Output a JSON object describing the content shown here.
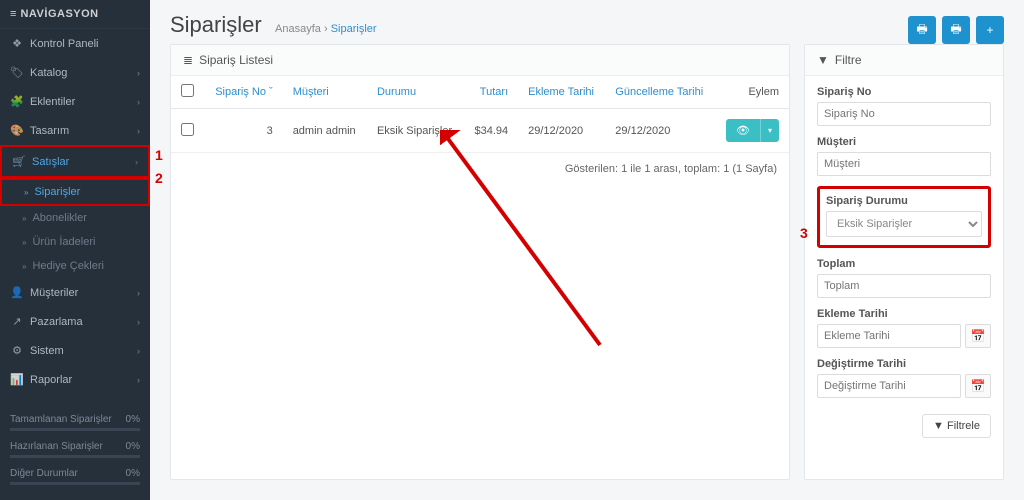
{
  "sidebar": {
    "title": "≡ NAVİGASYON",
    "items": [
      {
        "icon": "❖",
        "label": "Kontrol Paneli",
        "expandable": false
      },
      {
        "icon": "🏷",
        "label": "Katalog",
        "expandable": true
      },
      {
        "icon": "🧩",
        "label": "Eklentiler",
        "expandable": true
      },
      {
        "icon": "🎨",
        "label": "Tasarım",
        "expandable": true
      },
      {
        "icon": "🛒",
        "label": "Satışlar",
        "expandable": true,
        "active": true,
        "subs": [
          {
            "label": "Siparişler",
            "active": true
          },
          {
            "label": "Abonelikler"
          },
          {
            "label": "Ürün İadeleri"
          },
          {
            "label": "Hediye Çekleri"
          }
        ]
      },
      {
        "icon": "👤",
        "label": "Müşteriler",
        "expandable": true
      },
      {
        "icon": "↗",
        "label": "Pazarlama",
        "expandable": true
      },
      {
        "icon": "⚙",
        "label": "Sistem",
        "expandable": true
      },
      {
        "icon": "📊",
        "label": "Raporlar",
        "expandable": true
      }
    ],
    "gauges": [
      {
        "label": "Tamamlanan Siparişler",
        "value": "0%"
      },
      {
        "label": "Hazırlanan Siparişler",
        "value": "0%"
      },
      {
        "label": "Diğer Durumlar",
        "value": "0%"
      }
    ]
  },
  "page": {
    "title": "Siparişler",
    "breadcrumb": {
      "home": "Anasayfa",
      "sep": "›",
      "current": "Siparişler"
    },
    "actions": {
      "invoice_icon": "🖶",
      "shipping_icon": "🖶",
      "add_icon": "+"
    }
  },
  "list": {
    "panel_title": "Sipariş Listesi",
    "columns": {
      "siparis_no": "Sipariş No",
      "siparis_no_caret": "ˇ",
      "musteri": "Müşteri",
      "durumu": "Durumu",
      "tutari": "Tutarı",
      "ekleme": "Ekleme Tarihi",
      "guncelleme": "Güncelleme Tarihi",
      "eylem": "Eylem"
    },
    "rows": [
      {
        "id": "3",
        "musteri": "admin admin",
        "durumu": "Eksik Siparişler",
        "tutar": "$34.94",
        "ekleme": "29/12/2020",
        "guncelleme": "29/12/2020"
      }
    ],
    "view_icon": "👁",
    "pagination": "Gösterilen: 1 ile 1 arası, toplam: 1 (1 Sayfa)"
  },
  "filter": {
    "panel_title": "Filtre",
    "siparis_no": {
      "label": "Sipariş No",
      "placeholder": "Sipariş No"
    },
    "musteri": {
      "label": "Müşteri",
      "placeholder": "Müşteri"
    },
    "durum": {
      "label": "Sipariş Durumu",
      "selected": "Eksik Siparişler"
    },
    "toplam": {
      "label": "Toplam",
      "placeholder": "Toplam"
    },
    "ekleme": {
      "label": "Ekleme Tarihi",
      "placeholder": "Ekleme Tarihi"
    },
    "degistirme": {
      "label": "Değiştirme Tarihi",
      "placeholder": "Değiştirme Tarihi"
    },
    "button": "Filtrele",
    "funnel_icon": "▼",
    "cal_icon": "📅"
  },
  "annotations": {
    "one": "1",
    "two": "2",
    "three": "3"
  }
}
